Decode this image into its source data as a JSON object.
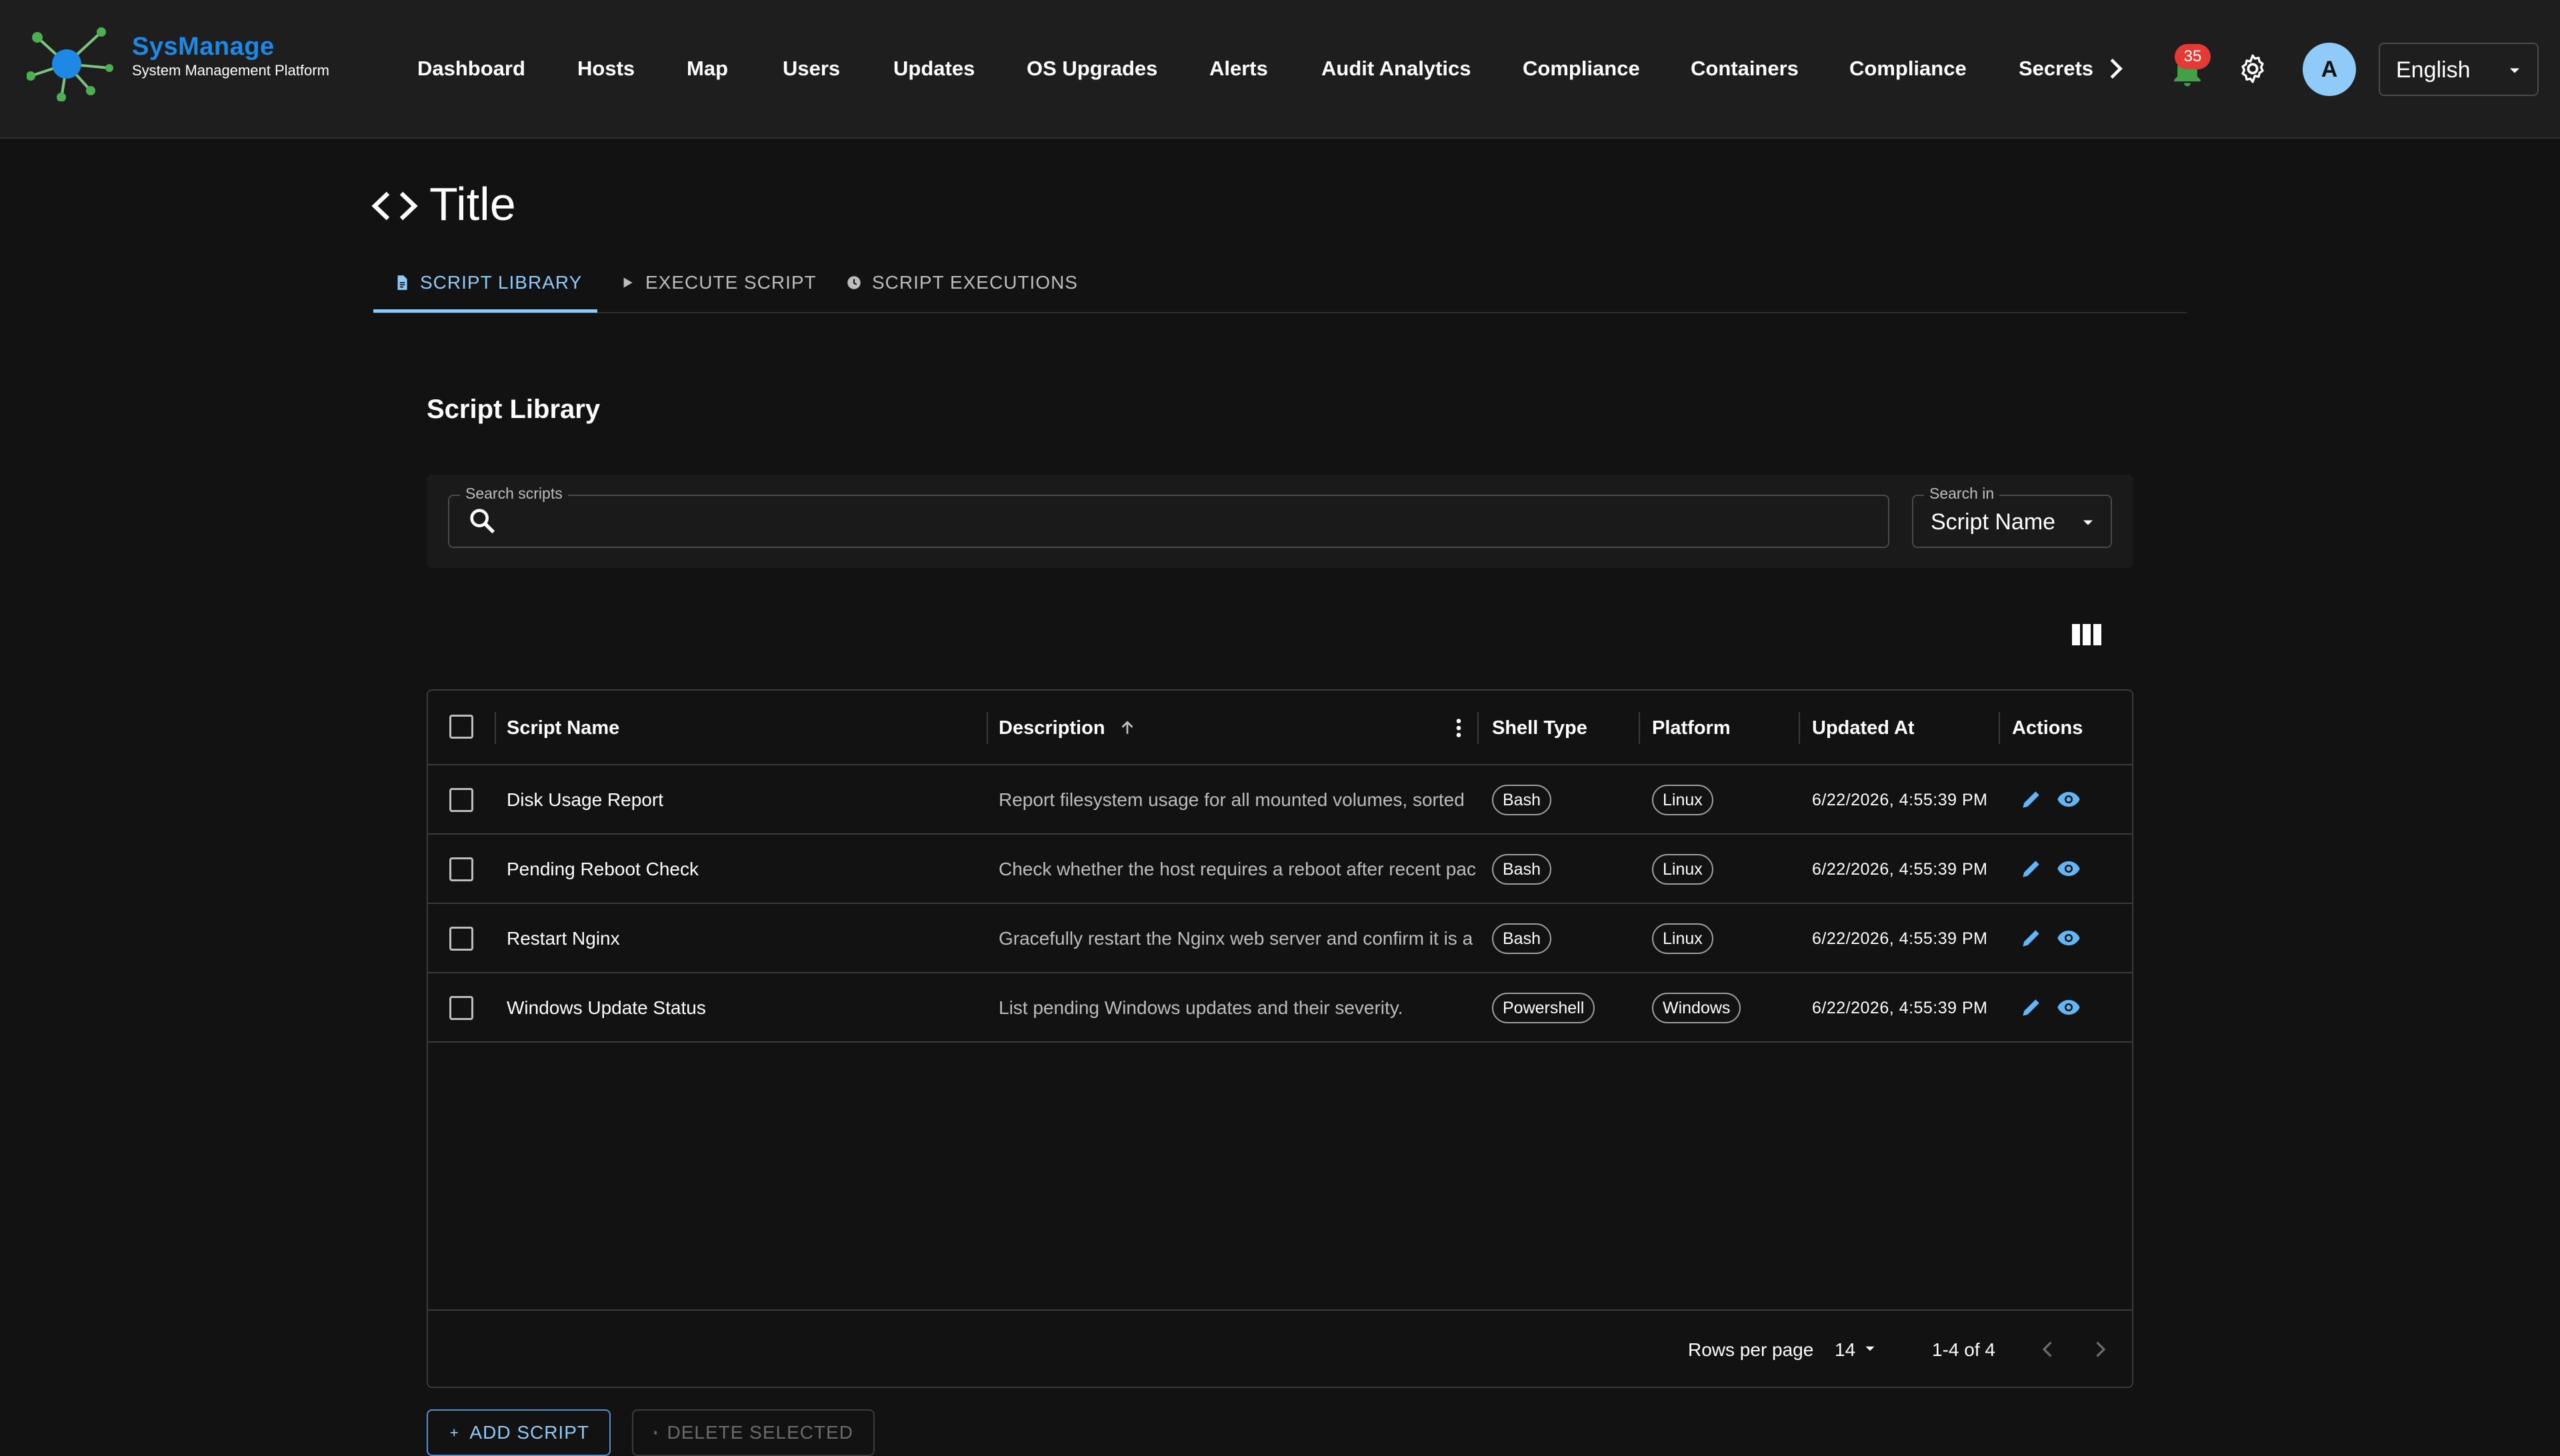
{
  "brand": {
    "name": "SysManage",
    "subtitle": "System Management Platform"
  },
  "nav": {
    "items": [
      "Dashboard",
      "Hosts",
      "Map",
      "Users",
      "Updates",
      "OS Upgrades",
      "Alerts",
      "Audit Analytics",
      "Compliance",
      "Containers",
      "Compliance",
      "Secrets"
    ],
    "more_icon": "chevron-right-icon"
  },
  "header": {
    "notifications_count": "35",
    "avatar_initial": "A",
    "language": "English"
  },
  "page": {
    "icon": "code-icon",
    "title": "Title",
    "tabs": [
      {
        "label": "SCRIPT LIBRARY",
        "icon": "document-icon",
        "active": true
      },
      {
        "label": "EXECUTE SCRIPT",
        "icon": "play-icon",
        "active": false
      },
      {
        "label": "SCRIPT EXECUTIONS",
        "icon": "clock-icon",
        "active": false
      }
    ]
  },
  "library": {
    "title": "Script Library",
    "search_label": "Search scripts",
    "search_value": "",
    "search_in_label": "Search in",
    "search_in_value": "Script Name"
  },
  "grid": {
    "columns": [
      "Script Name",
      "Description",
      "Shell Type",
      "Platform",
      "Updated At",
      "Actions"
    ],
    "sorted_column": "Description",
    "sort_direction": "ascending",
    "rows": [
      {
        "name": "Disk Usage Report",
        "description": "Report filesystem usage for all mounted volumes, sorted",
        "shell": "Bash",
        "platform": "Linux",
        "updated": "6/22/2026, 4:55:39 PM"
      },
      {
        "name": "Pending Reboot Check",
        "description": "Check whether the host requires a reboot after recent pac",
        "shell": "Bash",
        "platform": "Linux",
        "updated": "6/22/2026, 4:55:39 PM"
      },
      {
        "name": "Restart Nginx",
        "description": "Gracefully restart the Nginx web server and confirm it is a",
        "shell": "Bash",
        "platform": "Linux",
        "updated": "6/22/2026, 4:55:39 PM"
      },
      {
        "name": "Windows Update Status",
        "description": "List pending Windows updates and their severity.",
        "shell": "Powershell",
        "platform": "Windows",
        "updated": "6/22/2026, 4:55:39 PM"
      }
    ],
    "footer": {
      "rows_per_page_label": "Rows per page",
      "rows_per_page_value": "14",
      "range": "1-4 of 4"
    }
  },
  "buttons": {
    "add": "ADD SCRIPT",
    "delete": "DELETE SELECTED"
  },
  "colors": {
    "accent": "#90caf9",
    "brand": "#1e88e5",
    "badge": "#e53935",
    "bell": "#43a047",
    "background": "#121212"
  }
}
